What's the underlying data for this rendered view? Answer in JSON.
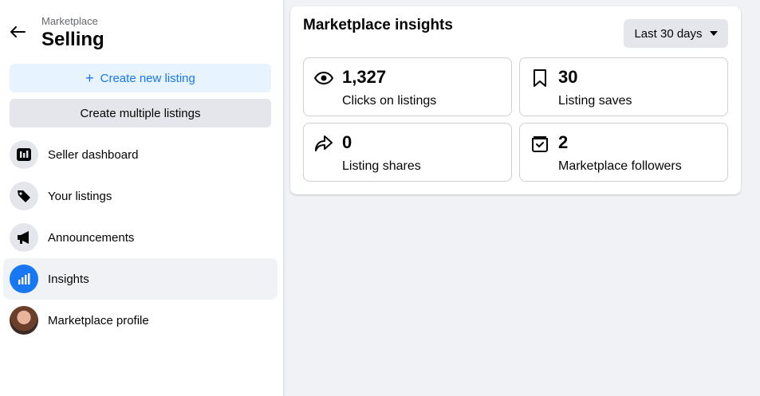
{
  "sidebar": {
    "breadcrumb": "Marketplace",
    "title": "Selling",
    "create_label": "Create new listing",
    "create_plus": "+",
    "multi_label": "Create multiple listings",
    "items": [
      {
        "label": "Seller dashboard",
        "icon": "dashboard-icon"
      },
      {
        "label": "Your listings",
        "icon": "tag-icon"
      },
      {
        "label": "Announcements",
        "icon": "megaphone-icon"
      },
      {
        "label": "Insights",
        "icon": "bar-chart-icon",
        "active": true
      },
      {
        "label": "Marketplace profile",
        "icon": "avatar"
      }
    ]
  },
  "main": {
    "title": "Marketplace insights",
    "range_label": "Last 30 days",
    "stats": [
      {
        "value": "1,327",
        "label": "Clicks on listings",
        "icon": "eye-icon"
      },
      {
        "value": "30",
        "label": "Listing saves",
        "icon": "bookmark-icon"
      },
      {
        "value": "0",
        "label": "Listing shares",
        "icon": "share-icon"
      },
      {
        "value": "2",
        "label": "Marketplace followers",
        "icon": "store-icon"
      }
    ]
  },
  "colors": {
    "accent": "#1877f2",
    "accent_bg": "#e7f3ff",
    "button_bg": "#e4e6eb",
    "page_bg": "#f0f2f5"
  }
}
